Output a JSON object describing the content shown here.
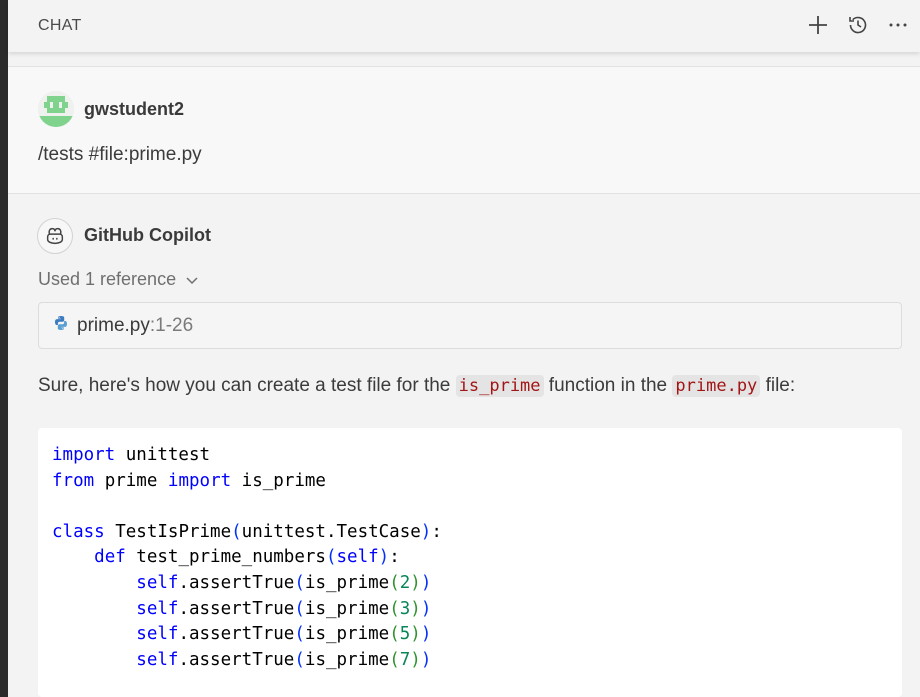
{
  "header": {
    "title": "CHAT"
  },
  "icons": {
    "new": "plus-icon",
    "history": "history-icon",
    "more": "more-icon"
  },
  "user_message": {
    "username": "gwstudent2",
    "text": "/tests #file:prime.py"
  },
  "assistant": {
    "name": "GitHub Copilot",
    "used_references": "Used 1 reference",
    "reference": {
      "file": "prime.py",
      "range": ":1-26"
    },
    "answer": {
      "before": "Sure, here's how you can create a test file for the ",
      "code1": "is_prime",
      "middle": " function in the ",
      "code2": "prime.py",
      "after": " file:"
    },
    "code": {
      "line1": {
        "k": "import",
        "t": " unittest"
      },
      "line2": {
        "k1": "from",
        "t1": " prime ",
        "k2": "import",
        "t2": " is_prime"
      },
      "line4": {
        "k": "class",
        "t1": " TestIsPrime",
        "p1": "(",
        "t2": "unittest.TestCase",
        "p2": ")",
        "t3": ":"
      },
      "line5": {
        "indent": "    ",
        "k": "def",
        "t1": " test_prime_numbers",
        "p1": "(",
        "s": "self",
        "p2": ")",
        "t2": ":"
      },
      "asserts": [
        {
          "indent": "        ",
          "s": "self",
          "t1": ".assertTrue",
          "p1": "(",
          "t2": "is_prime",
          "p2": "(",
          "n": "2",
          "p3": ")",
          "p4": ")"
        },
        {
          "indent": "        ",
          "s": "self",
          "t1": ".assertTrue",
          "p1": "(",
          "t2": "is_prime",
          "p2": "(",
          "n": "3",
          "p3": ")",
          "p4": ")"
        },
        {
          "indent": "        ",
          "s": "self",
          "t1": ".assertTrue",
          "p1": "(",
          "t2": "is_prime",
          "p2": "(",
          "n": "5",
          "p3": ")",
          "p4": ")"
        },
        {
          "indent": "        ",
          "s": "self",
          "t1": ".assertTrue",
          "p1": "(",
          "t2": "is_prime",
          "p2": "(",
          "n": "7",
          "p3": ")",
          "p4": ")"
        }
      ]
    }
  },
  "colors": {
    "keyword": "#0000ff",
    "number": "#098658",
    "inline_code": "#a31515",
    "bracket1": "#0431fa",
    "bracket2": "#319331"
  }
}
